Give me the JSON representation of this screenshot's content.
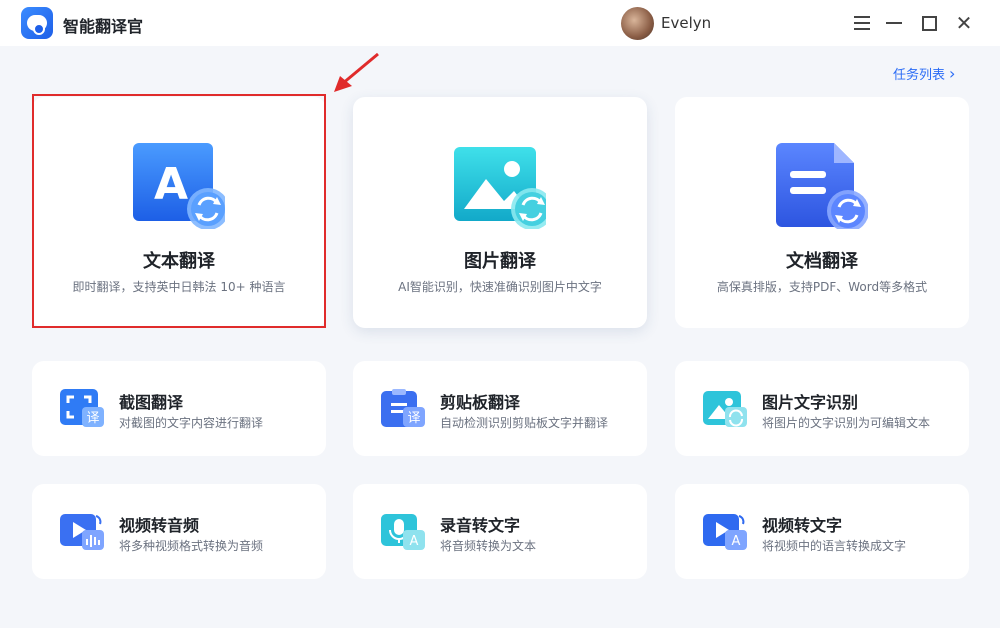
{
  "app": {
    "title": "智能翻译官",
    "user_name": "Evelyn"
  },
  "header": {
    "task_list_label": "任务列表",
    "task_list_chevron": "›"
  },
  "main_cards": [
    {
      "title": "文本翻译",
      "desc": "即时翻译，支持英中日韩法 10+ 种语言",
      "icon": "text-translate-icon",
      "color": "#2f7bf5"
    },
    {
      "title": "图片翻译",
      "desc": "AI智能识别，快速准确识别图片中文字",
      "icon": "image-translate-icon",
      "color": "#19c3d6"
    },
    {
      "title": "文档翻译",
      "desc": "高保真排版，支持PDF、Word等多格式",
      "icon": "document-translate-icon",
      "color": "#3d6cf0"
    }
  ],
  "tool_cards": [
    {
      "title": "截图翻译",
      "desc": "对截图的文字内容进行翻译",
      "icon": "screenshot-translate-icon",
      "badge": "译"
    },
    {
      "title": "剪贴板翻译",
      "desc": "自动检测识别剪贴板文字并翻译",
      "icon": "clipboard-translate-icon",
      "badge": "译"
    },
    {
      "title": "图片文字识别",
      "desc": "将图片的文字识别为可编辑文本",
      "icon": "image-ocr-icon",
      "badge": ""
    },
    {
      "title": "视频转音频",
      "desc": "将多种视频格式转换为音频",
      "icon": "video-to-audio-icon",
      "badge": ""
    },
    {
      "title": "录音转文字",
      "desc": "将音频转换为文本",
      "icon": "audio-to-text-icon",
      "badge": "A"
    },
    {
      "title": "视频转文字",
      "desc": "将视频中的语言转换成文字",
      "icon": "video-to-text-icon",
      "badge": "A"
    }
  ],
  "colors": {
    "accent": "#2b6cf6",
    "highlight_border": "#e02b2b",
    "background": "#f4f6fa"
  }
}
